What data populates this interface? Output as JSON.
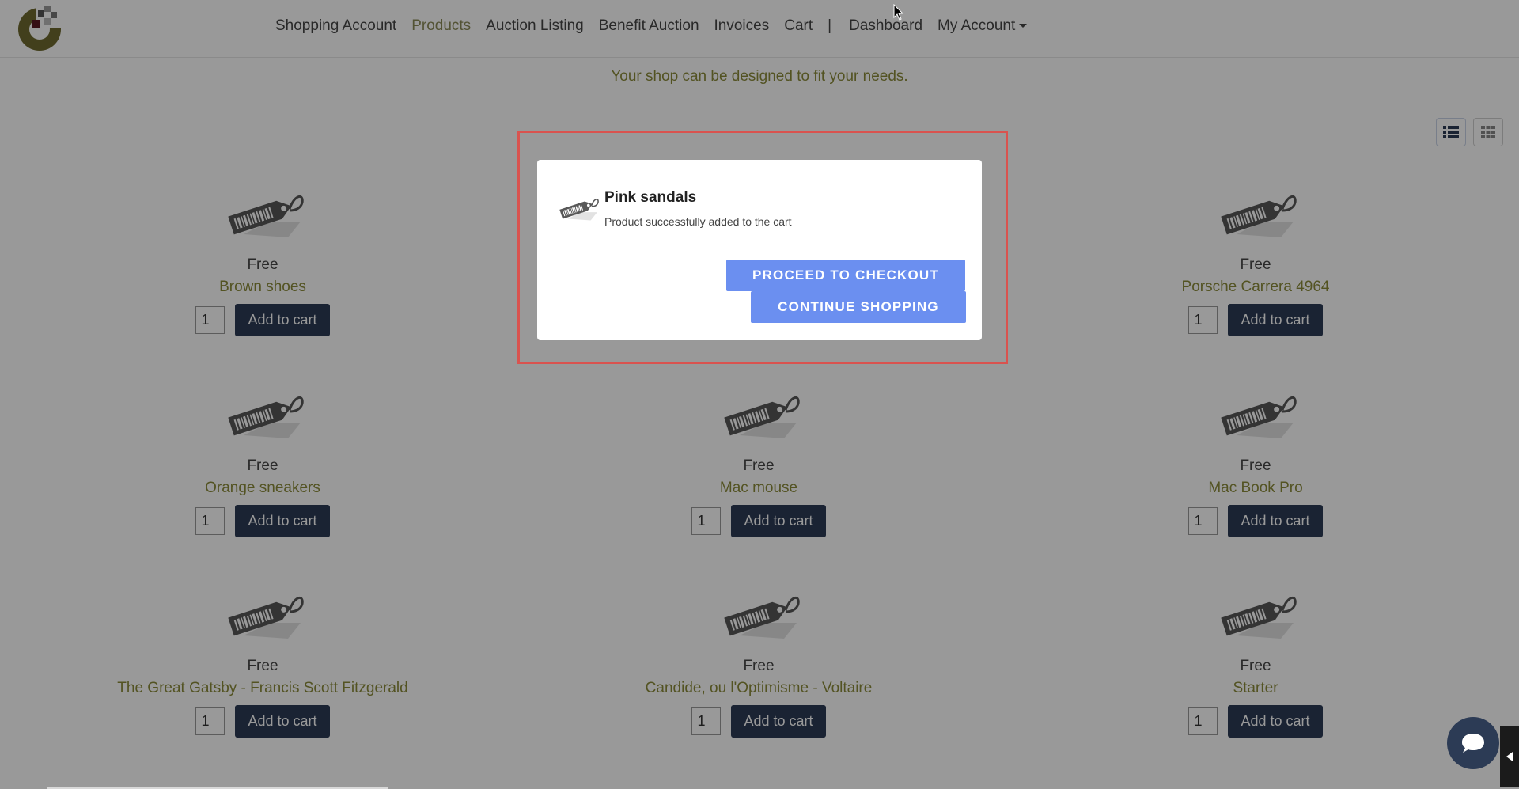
{
  "nav": {
    "items": [
      {
        "label": "Shopping Account"
      },
      {
        "label": "Products",
        "active": true
      },
      {
        "label": "Auction Listing"
      },
      {
        "label": "Benefit Auction"
      },
      {
        "label": "Invoices"
      },
      {
        "label": "Cart"
      }
    ],
    "separator": "|",
    "dashboard": "Dashboard",
    "account": "My Account"
  },
  "tagline": "Your shop can be designed to fit your needs.",
  "view_toggle": {
    "list_icon": "list-view-icon",
    "grid_icon": "grid-view-icon"
  },
  "products": [
    {
      "price": "Free",
      "name": "Brown shoes",
      "qty": "1",
      "button": "Add to cart"
    },
    {
      "price": "",
      "name": "",
      "qty": "",
      "button": ""
    },
    {
      "price": "Free",
      "name": "Porsche Carrera 4964",
      "qty": "1",
      "button": "Add to cart"
    },
    {
      "price": "Free",
      "name": "Orange sneakers",
      "qty": "1",
      "button": "Add to cart"
    },
    {
      "price": "Free",
      "name": "Mac mouse",
      "qty": "1",
      "button": "Add to cart"
    },
    {
      "price": "Free",
      "name": "Mac Book Pro",
      "qty": "1",
      "button": "Add to cart"
    },
    {
      "price": "Free",
      "name": "The Great Gatsby - Francis Scott Fitzgerald",
      "qty": "1",
      "button": "Add to cart"
    },
    {
      "price": "Free",
      "name": "Candide, ou l'Optimisme - Voltaire",
      "qty": "1",
      "button": "Add to cart"
    },
    {
      "price": "Free",
      "name": "Starter",
      "qty": "1",
      "button": "Add to cart"
    }
  ],
  "modal": {
    "title": "Pink sandals",
    "message": "Product successfully added to the cart",
    "checkout_label": "PROCEED TO CHECKOUT",
    "continue_label": "CONTINUE SHOPPING"
  },
  "colors": {
    "accent_text": "#8a8a3a",
    "button_dark": "#2c3b55",
    "modal_button": "#6b8ff0",
    "highlight_border": "#d9534f"
  }
}
